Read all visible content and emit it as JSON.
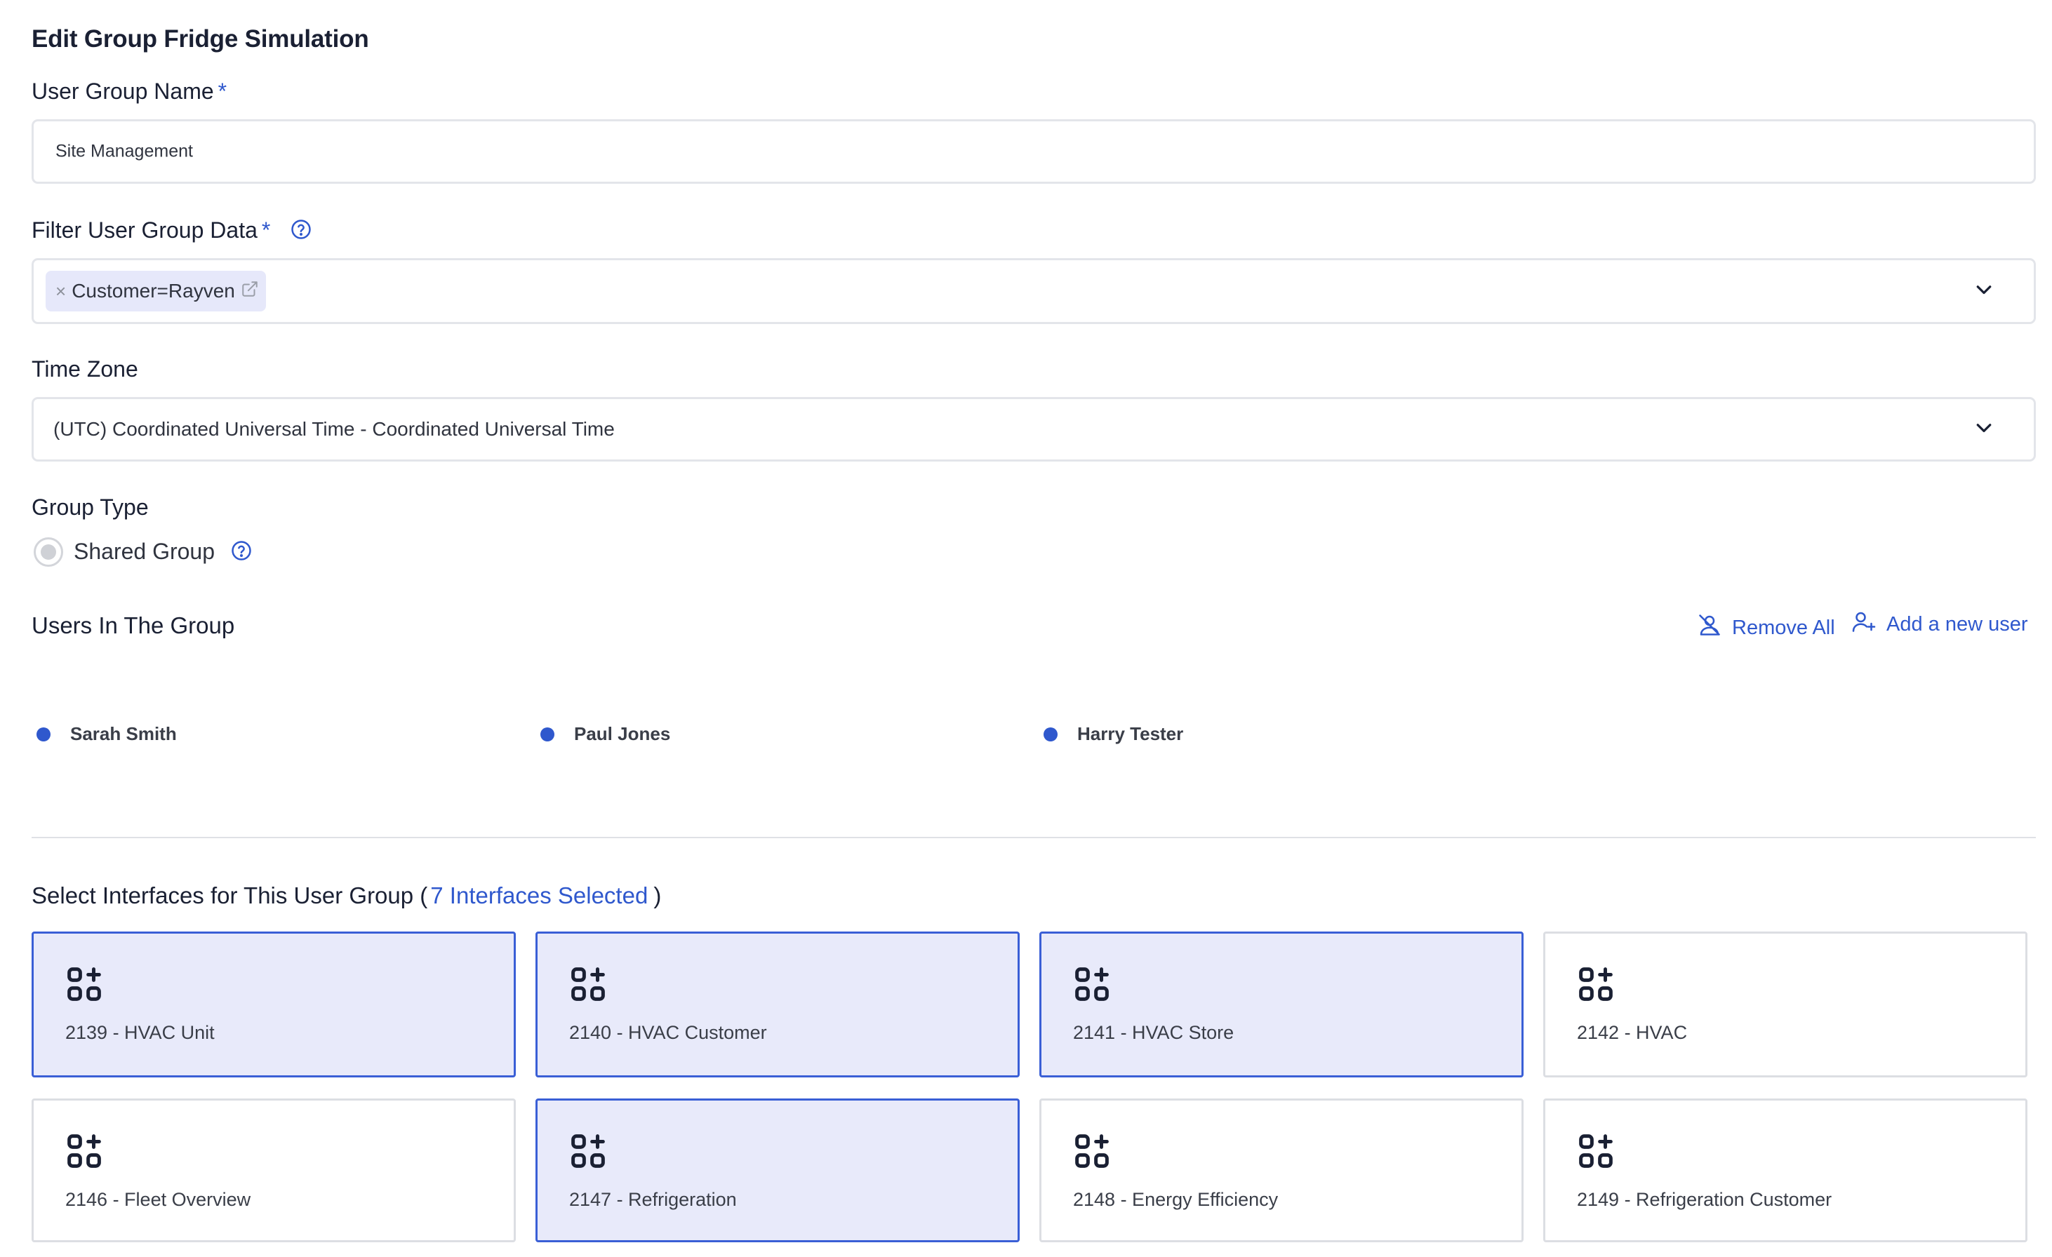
{
  "page": {
    "title": "Edit Group Fridge Simulation"
  },
  "group_name": {
    "label": "User Group Name",
    "required_mark": "*",
    "value": "Site Management"
  },
  "filter": {
    "label": "Filter User Group Data",
    "required_mark": "*",
    "chips": [
      {
        "label": "Customer=Rayven",
        "remove_glyph": "×"
      }
    ]
  },
  "time_zone": {
    "label": "Time Zone",
    "value": "(UTC) Coordinated Universal Time - Coordinated Universal Time"
  },
  "group_type": {
    "label": "Group Type",
    "option_label": "Shared Group"
  },
  "users_section": {
    "title": "Users In The Group",
    "remove_all_label": "Remove All",
    "add_user_label": "Add a new user",
    "users": [
      "Sarah Smith",
      "Paul Jones",
      "Harry Tester"
    ]
  },
  "interfaces_section": {
    "title_prefix": "Select Interfaces for This User Group (",
    "selected_count_label": "7 Interfaces Selected",
    "title_suffix": ")",
    "items": [
      {
        "label": "2139 - HVAC Unit",
        "selected": true
      },
      {
        "label": "2140 - HVAC Customer",
        "selected": true
      },
      {
        "label": "2141 - HVAC Store",
        "selected": true
      },
      {
        "label": "2142 - HVAC",
        "selected": false
      },
      {
        "label": "2146 - Fleet Overview",
        "selected": false
      },
      {
        "label": "2147 - Refrigeration",
        "selected": true
      },
      {
        "label": "2148 - Energy Efficiency",
        "selected": false
      },
      {
        "label": "2149 - Refrigeration Customer",
        "selected": false
      }
    ]
  },
  "colors": {
    "accent": "#2f58cd",
    "selected_card_bg": "#e8eafa",
    "chip_bg": "#e6e8fa"
  },
  "icons": {
    "help": "question-circle-icon",
    "chevron": "chevron-down-icon",
    "external_link": "external-link-icon",
    "remove_user": "user-slash-icon",
    "add_user": "user-plus-icon",
    "interface": "apps-add-icon"
  }
}
